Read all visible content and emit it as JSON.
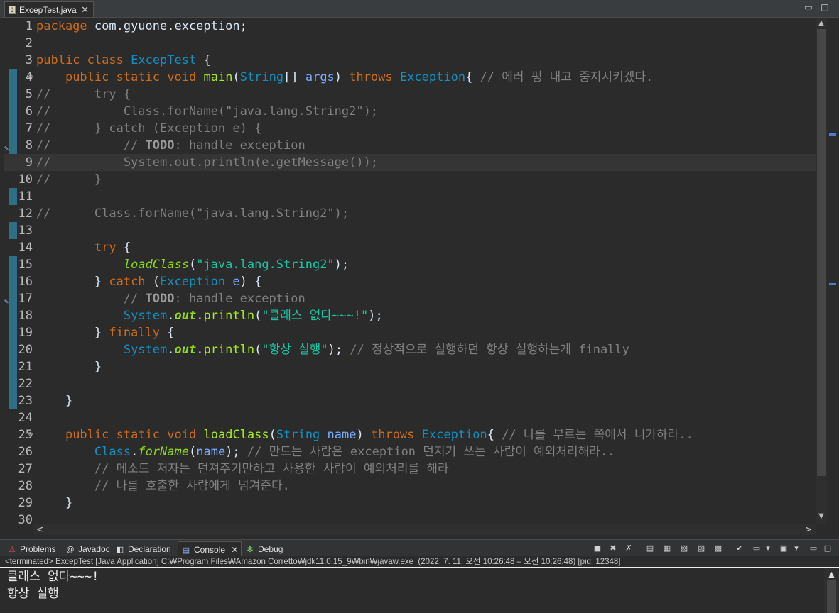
{
  "editor_tab": {
    "title": "ExcepTest.java",
    "close": "✕"
  },
  "window_controls": {
    "minimize": "▭",
    "maximize": "□"
  },
  "code_lines": [
    {
      "n": "1",
      "parts": [
        {
          "t": "package",
          "c": "kw"
        },
        {
          "t": " com.gyuone.exception;"
        }
      ]
    },
    {
      "n": "2",
      "parts": []
    },
    {
      "n": "3",
      "parts": [
        {
          "t": "public",
          "c": "kw"
        },
        {
          "t": " "
        },
        {
          "t": "class",
          "c": "kw"
        },
        {
          "t": " "
        },
        {
          "t": "ExcepTest",
          "c": "ty"
        },
        {
          "t": " {"
        }
      ]
    },
    {
      "n": "4",
      "fold": "⊖",
      "parts": [
        {
          "t": "    "
        },
        {
          "t": "public",
          "c": "kw"
        },
        {
          "t": " "
        },
        {
          "t": "static",
          "c": "kw"
        },
        {
          "t": " "
        },
        {
          "t": "void",
          "c": "kw"
        },
        {
          "t": " "
        },
        {
          "t": "main",
          "c": "fn"
        },
        {
          "t": "("
        },
        {
          "t": "String",
          "c": "ty"
        },
        {
          "t": "[] "
        },
        {
          "t": "args",
          "c": "param"
        },
        {
          "t": ") "
        },
        {
          "t": "throws",
          "c": "kw"
        },
        {
          "t": " "
        },
        {
          "t": "Exception",
          "c": "ty"
        },
        {
          "t": "{ "
        },
        {
          "t": "// 에러 펑 내고 중지시키겠다.",
          "c": "cm"
        }
      ]
    },
    {
      "n": "5",
      "parts": [
        {
          "t": "//      try {",
          "c": "cm"
        }
      ]
    },
    {
      "n": "6",
      "parts": [
        {
          "t": "//          Class.forName(\"java.lang.String2\");",
          "c": "cm"
        }
      ]
    },
    {
      "n": "7",
      "parts": [
        {
          "t": "//      } catch (Exception e) {",
          "c": "cm"
        }
      ]
    },
    {
      "n": "8",
      "marker": "✎",
      "parts": [
        {
          "t": "//          // ",
          "c": "cm"
        },
        {
          "t": "TODO",
          "c": "td"
        },
        {
          "t": ": handle exception",
          "c": "cm"
        }
      ]
    },
    {
      "n": "9",
      "current": true,
      "parts": [
        {
          "t": "//          System.out.println(e.getMessage());",
          "c": "cm"
        }
      ]
    },
    {
      "n": "10",
      "parts": [
        {
          "t": "//      }",
          "c": "cm"
        }
      ]
    },
    {
      "n": "11",
      "parts": []
    },
    {
      "n": "12",
      "parts": [
        {
          "t": "//      Class.forName(\"java.lang.String2\");",
          "c": "cm"
        }
      ]
    },
    {
      "n": "13",
      "parts": []
    },
    {
      "n": "14",
      "parts": [
        {
          "t": "        "
        },
        {
          "t": "try",
          "c": "kw"
        },
        {
          "t": " {"
        }
      ]
    },
    {
      "n": "15",
      "parts": [
        {
          "t": "            "
        },
        {
          "t": "loadClass",
          "c": "sf"
        },
        {
          "t": "("
        },
        {
          "t": "\"java.lang.String2\"",
          "c": "st"
        },
        {
          "t": ");"
        }
      ]
    },
    {
      "n": "16",
      "parts": [
        {
          "t": "        } "
        },
        {
          "t": "catch",
          "c": "kw"
        },
        {
          "t": " ("
        },
        {
          "t": "Exception",
          "c": "ty"
        },
        {
          "t": " "
        },
        {
          "t": "e",
          "c": "param"
        },
        {
          "t": ") {"
        }
      ]
    },
    {
      "n": "17",
      "marker": "✎",
      "parts": [
        {
          "t": "            // ",
          "c": "cm"
        },
        {
          "t": "TODO",
          "c": "td"
        },
        {
          "t": ": handle exception",
          "c": "cm"
        }
      ]
    },
    {
      "n": "18",
      "parts": [
        {
          "t": "            "
        },
        {
          "t": "System",
          "c": "ty"
        },
        {
          "t": "."
        },
        {
          "t": "out",
          "c": "stat"
        },
        {
          "t": "."
        },
        {
          "t": "println",
          "c": "fn"
        },
        {
          "t": "("
        },
        {
          "t": "\"클래스 없다~~~!\"",
          "c": "st"
        },
        {
          "t": ");"
        }
      ]
    },
    {
      "n": "19",
      "parts": [
        {
          "t": "        } "
        },
        {
          "t": "finally",
          "c": "kw"
        },
        {
          "t": " {"
        }
      ]
    },
    {
      "n": "20",
      "parts": [
        {
          "t": "            "
        },
        {
          "t": "System",
          "c": "ty"
        },
        {
          "t": "."
        },
        {
          "t": "out",
          "c": "stat"
        },
        {
          "t": "."
        },
        {
          "t": "println",
          "c": "fn"
        },
        {
          "t": "("
        },
        {
          "t": "\"항상 실행\"",
          "c": "st"
        },
        {
          "t": "); "
        },
        {
          "t": "// 정상적으로 실행하던 항상 실행하는게 finally",
          "c": "cm"
        }
      ]
    },
    {
      "n": "21",
      "parts": [
        {
          "t": "        }"
        }
      ]
    },
    {
      "n": "22",
      "parts": []
    },
    {
      "n": "23",
      "parts": [
        {
          "t": "    }"
        }
      ]
    },
    {
      "n": "24",
      "parts": []
    },
    {
      "n": "25",
      "fold": "⊖",
      "parts": [
        {
          "t": "    "
        },
        {
          "t": "public",
          "c": "kw"
        },
        {
          "t": " "
        },
        {
          "t": "static",
          "c": "kw"
        },
        {
          "t": " "
        },
        {
          "t": "void",
          "c": "kw"
        },
        {
          "t": " "
        },
        {
          "t": "loadClass",
          "c": "fn"
        },
        {
          "t": "("
        },
        {
          "t": "String",
          "c": "ty"
        },
        {
          "t": " "
        },
        {
          "t": "name",
          "c": "param"
        },
        {
          "t": ") "
        },
        {
          "t": "throws",
          "c": "kw"
        },
        {
          "t": " "
        },
        {
          "t": "Exception",
          "c": "ty"
        },
        {
          "t": "{ "
        },
        {
          "t": "// 나를 부르는 쪽에서 니가하라..",
          "c": "cm"
        }
      ]
    },
    {
      "n": "26",
      "parts": [
        {
          "t": "        "
        },
        {
          "t": "Class",
          "c": "ty"
        },
        {
          "t": "."
        },
        {
          "t": "forName",
          "c": "sf"
        },
        {
          "t": "("
        },
        {
          "t": "name",
          "c": "param"
        },
        {
          "t": "); "
        },
        {
          "t": "// 만드는 사람은 exception 던지기 쓰는 사람이 예외처리해라..",
          "c": "cm"
        }
      ]
    },
    {
      "n": "27",
      "parts": [
        {
          "t": "        // 메소드 저자는 던져주기만하고 사용한 사람이 예외처리를 해라",
          "c": "cm"
        }
      ]
    },
    {
      "n": "28",
      "parts": [
        {
          "t": "        // 나를 호출한 사람에게 넘겨준다.",
          "c": "cm"
        }
      ]
    },
    {
      "n": "29",
      "parts": [
        {
          "t": "    }"
        }
      ]
    },
    {
      "n": "30",
      "parts": []
    }
  ],
  "scroll": {
    "up": "▲",
    "down": "▼",
    "left": "<",
    "right": ">"
  },
  "panel_tabs": [
    {
      "id": "problems",
      "label": "Problems",
      "icon": "⚠"
    },
    {
      "id": "javadoc",
      "label": "Javadoc",
      "icon": "@"
    },
    {
      "id": "declaration",
      "label": "Declaration",
      "icon": "◧"
    },
    {
      "id": "console",
      "label": "Console",
      "icon": "▤",
      "close": "✕"
    },
    {
      "id": "debug",
      "label": "Debug",
      "icon": "✻"
    }
  ],
  "console_toolbar": [
    "■",
    "✖",
    "✗",
    "▤",
    "▦",
    "▧",
    "▨",
    "▩",
    "✔",
    "▭",
    "▾",
    "▣",
    "▾"
  ],
  "panel_controls": {
    "minimize": "▭",
    "maximize": "□"
  },
  "console_status": "<terminated> ExcepTest [Java Application] C:₩Program Files₩Amazon Corretto₩jdk11.0.15_9₩bin₩javaw.exe  (2022. 7. 11. 오전 10:26:48 – 오전 10:26:48) [pid: 12348]",
  "console_output": [
    "클래스 없다~~~!",
    "항상 실행"
  ],
  "colors": {
    "keyword": "#cc6c1d",
    "type": "#1290c3",
    "comment": "#808080",
    "string": "#17c6a3",
    "method": "#a7ec21",
    "background": "#2b2b2b"
  }
}
